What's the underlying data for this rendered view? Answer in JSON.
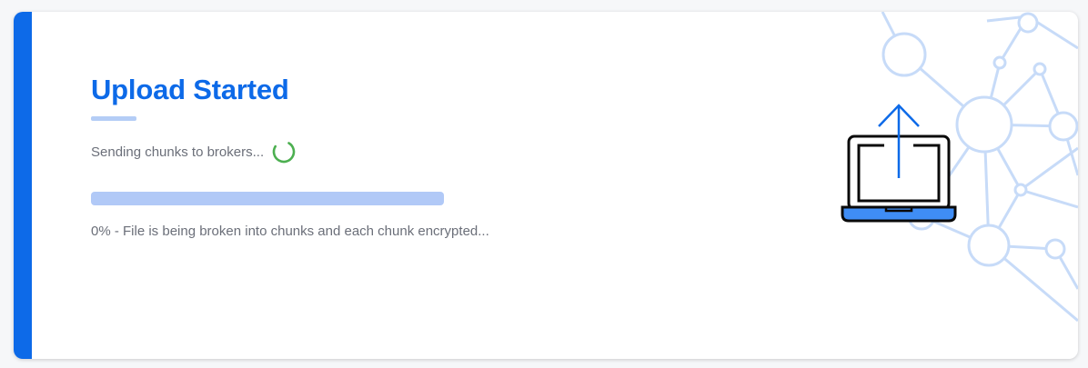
{
  "upload": {
    "title": "Upload Started",
    "status_text": "Sending chunks to brokers...",
    "progress_percent": 0,
    "progress_caption": "0% - File is being broken into chunks and each chunk encrypted..."
  },
  "icons": {
    "spinner": "loading-spinner-icon",
    "illustration": "laptop-upload-icon",
    "background": "network-nodes-graphic"
  },
  "colors": {
    "accent": "#0d6ae8",
    "accent_light": "#b4cdf6",
    "progress_track": "#b1c9f7",
    "spinner": "#4caf50",
    "text_muted": "#6b6f79",
    "network": "#c7dbf8"
  }
}
